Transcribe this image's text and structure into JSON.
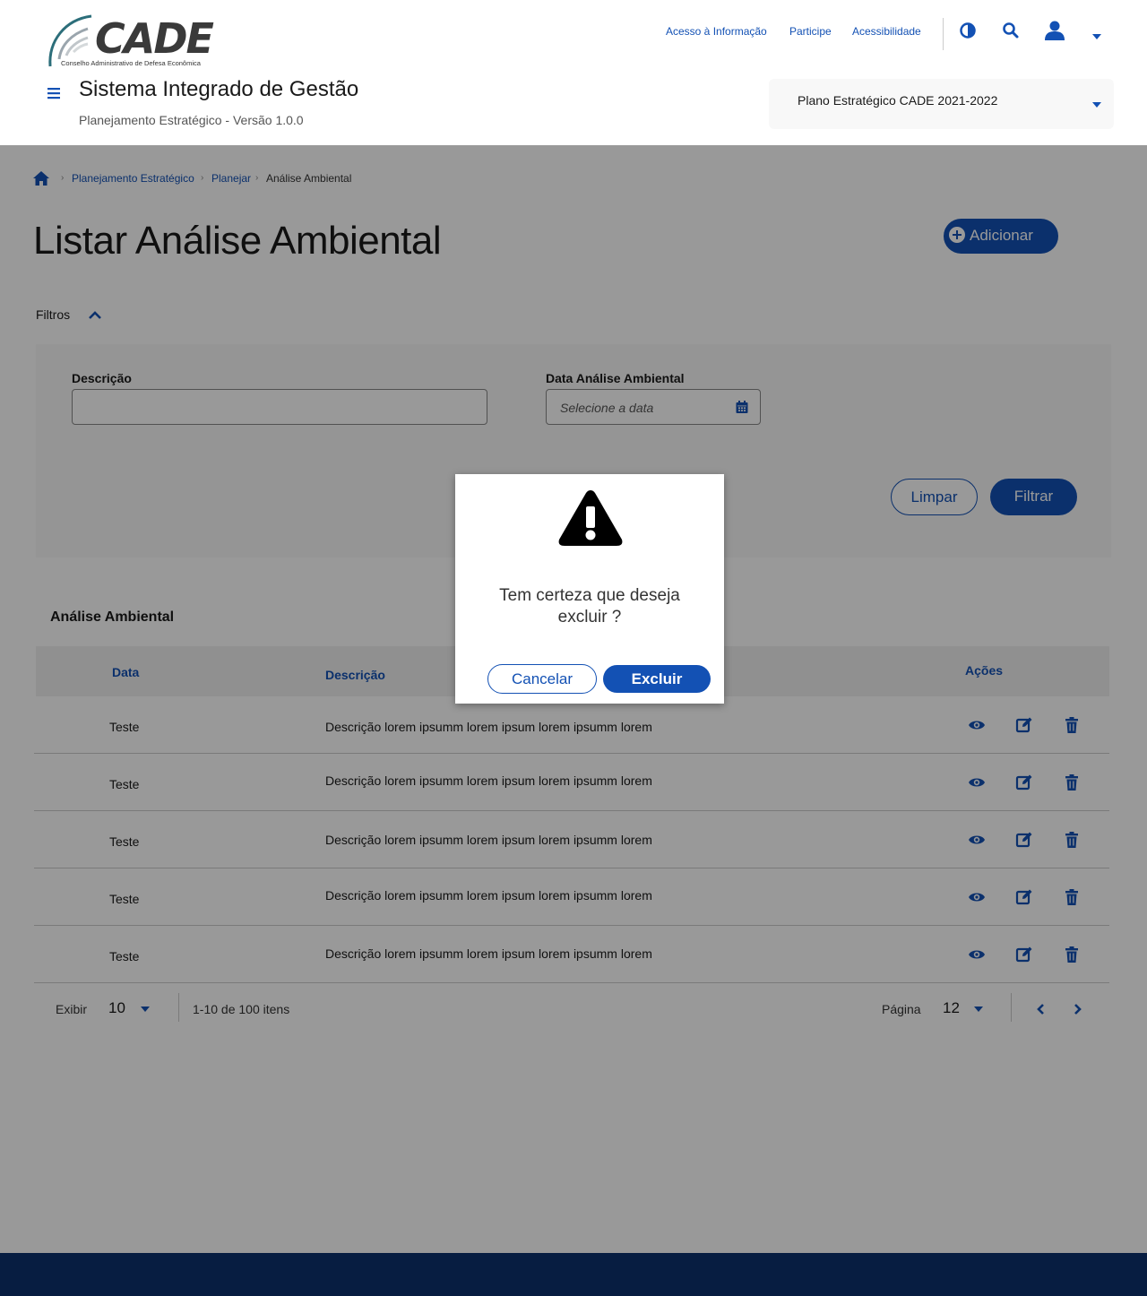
{
  "header": {
    "logo_text": "CADE",
    "logo_subtitle": "Conselho Administrativo de Defesa Econômica",
    "links": [
      "Acesso à Informação",
      "Participe",
      "Acessibilidade"
    ],
    "system_title": "Sistema Integrado de Gestão",
    "system_subtitle": "Planejamento Estratégico - Versão 1.0.0",
    "plan_select": "Plano Estratégico CADE 2021-2022"
  },
  "breadcrumb": [
    "Planejamento Estratégico",
    "Planejar",
    "Análise Ambiental"
  ],
  "page": {
    "title": "Listar Análise Ambiental",
    "add_button": "Adicionar"
  },
  "filters": {
    "label": "Filtros",
    "descricao_label": "Descrição",
    "descricao_value": "",
    "data_label": "Data  Análise Ambiental",
    "data_placeholder": "Selecione a data",
    "clear_button": "Limpar",
    "filter_button": "Filtrar"
  },
  "table": {
    "title": "Análise Ambiental",
    "columns": [
      "Data",
      "Descrição",
      "Ações"
    ],
    "rows": [
      {
        "data": "Teste",
        "descricao": "Descrição lorem ipsumm lorem ipsum lorem ipsumm lorem"
      },
      {
        "data": "Teste",
        "descricao": "Descrição lorem ipsumm lorem ipsum lorem ipsumm lorem"
      },
      {
        "data": "Teste",
        "descricao": "Descrição lorem ipsumm lorem ipsum lorem ipsumm lorem"
      },
      {
        "data": "Teste",
        "descricao": "Descrição lorem ipsumm lorem ipsum lorem ipsumm lorem"
      },
      {
        "data": "Teste",
        "descricao": "Descrição lorem ipsumm lorem ipsum lorem ipsumm lorem"
      }
    ]
  },
  "pagination": {
    "show_label": "Exibir",
    "per_page": "10",
    "range_text": "1-10 de 100 itens",
    "page_label": "Página",
    "page": "12"
  },
  "modal": {
    "message": "Tem certeza que deseja excluir ?",
    "cancel": "Cancelar",
    "confirm": "Excluir"
  },
  "icons": {
    "contrast": "contrast-icon",
    "search": "search-icon",
    "user": "user-icon",
    "home": "home-icon",
    "calendar": "calendar-icon",
    "view": "eye-icon",
    "edit": "edit-icon",
    "delete": "trash-icon",
    "warning": "warning-icon"
  },
  "colors": {
    "primary": "#1351b4",
    "footer": "#071d41",
    "filter_bg": "#f8f8f8"
  }
}
